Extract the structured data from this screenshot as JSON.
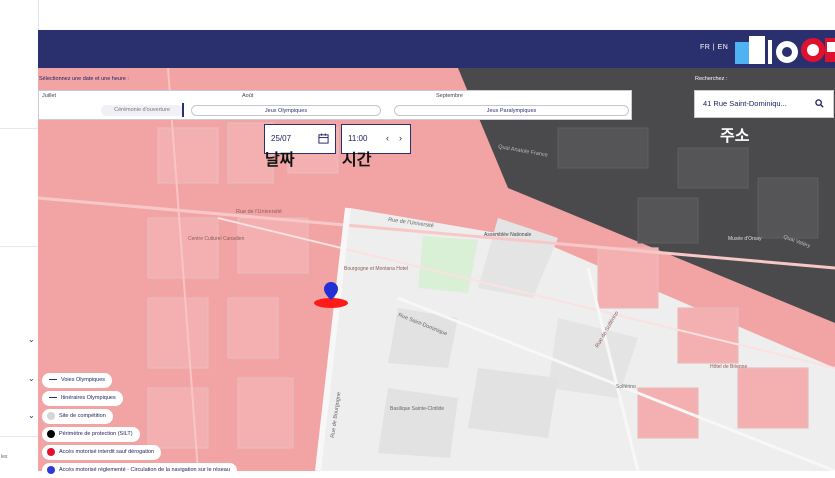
{
  "header": {
    "lang_fr": "FR",
    "lang_en": "EN",
    "lang_sep": "|"
  },
  "date_selector": {
    "label": "Sélectionnez une date et une heure :",
    "months": [
      "Juillet",
      "Août",
      "Septembre"
    ],
    "events": [
      "Cérémonie d'ouverture",
      "Jeux Olympiques",
      "Jeux Paralympiques"
    ]
  },
  "search": {
    "label": "Recherchez :",
    "value": "41 Rue Saint-Dominiqu..."
  },
  "date_input": {
    "value": "25/07"
  },
  "time_input": {
    "value": "11:00",
    "prev": "‹",
    "next": "›"
  },
  "annotations": {
    "date": "날짜",
    "time": "시간",
    "address": "주소"
  },
  "map": {
    "streets": [
      "Rue de l'Université",
      "Rue de l'Université",
      "Rue Saint-Dominique",
      "Rue de Bourgogne",
      "Rue de Solférino",
      "Quai Anatole France",
      "Quai Valéry"
    ],
    "pois": [
      "Assemblée Nationale",
      "Basilique Sainte-Clotilde",
      "Musée d'Orsay",
      "Hôtel de Brienne",
      "Bourgogne et Montana Hotel",
      "Solférino",
      "Centre Culturel Canadien"
    ]
  },
  "legend": [
    {
      "label": "Voies Olympiques",
      "kind": "line",
      "color": "#2a2f6e"
    },
    {
      "label": "Itinéraires Olympiques",
      "kind": "line",
      "color": "#2a2f6e"
    },
    {
      "label": "Site de compétition",
      "kind": "dot",
      "color": "#d5d5d5"
    },
    {
      "label": "Périmètre de protection (SILT)",
      "kind": "dot",
      "color": "#000000"
    },
    {
      "label": "Accès motorisé interdit sauf dérogation",
      "kind": "dot",
      "color": "#e0112f"
    },
    {
      "label": "Accès motorisé réglementé - Circulation de la navigation sur le réseau",
      "kind": "dot",
      "color": "#2e3ad8"
    }
  ],
  "sidebar_misc": {
    "les": "les"
  },
  "colors": {
    "header": "#2a2f6e",
    "red_zone": "#f2a4a4",
    "dark_zone": "#4a4a4d",
    "marker": "#2230d6"
  }
}
